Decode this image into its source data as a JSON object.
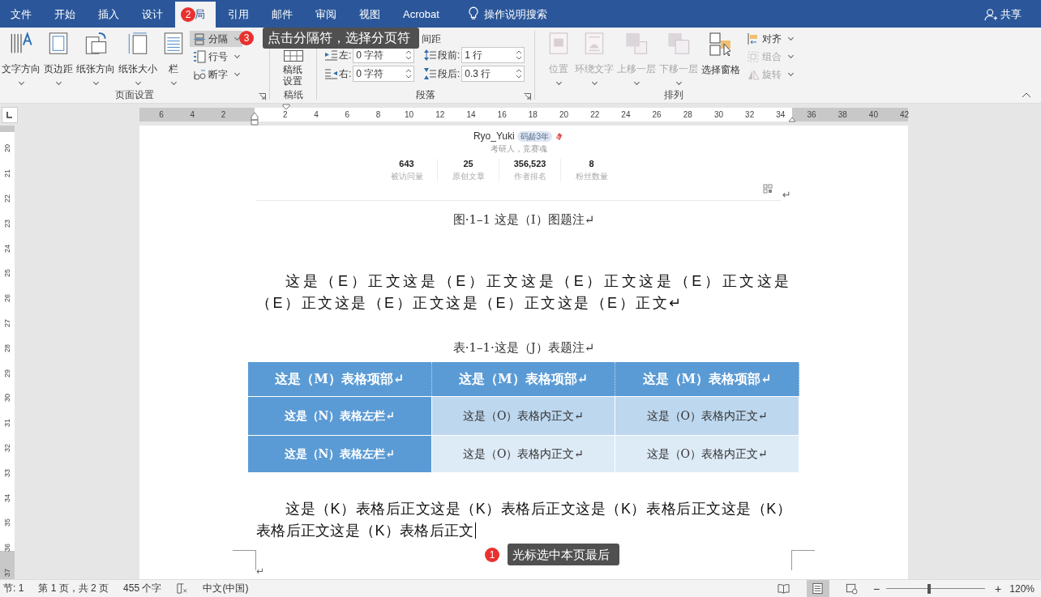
{
  "tabs": [
    {
      "label": "文件",
      "selected": false
    },
    {
      "label": "开始",
      "selected": false
    },
    {
      "label": "插入",
      "selected": false
    },
    {
      "label": "设计",
      "selected": false
    },
    {
      "label": "局",
      "selected": true,
      "badge": "2"
    },
    {
      "label": "引用",
      "selected": false
    },
    {
      "label": "邮件",
      "selected": false
    },
    {
      "label": "审阅",
      "selected": false
    },
    {
      "label": "视图",
      "selected": false
    },
    {
      "label": "Acrobat",
      "selected": false
    }
  ],
  "tell_me": "操作说明搜索",
  "share": "共享",
  "page_setup": {
    "title": "页面设置",
    "buttons": [
      {
        "label": "文字方向"
      },
      {
        "label": "页边距"
      },
      {
        "label": "纸张方向"
      },
      {
        "label": "纸张大小"
      },
      {
        "label": "栏"
      }
    ],
    "small": [
      {
        "label": "分隔",
        "selected": true
      },
      {
        "label": "行号",
        "selected": false
      },
      {
        "label": "断字",
        "selected": false
      }
    ]
  },
  "manuscript": {
    "title": "稿纸",
    "button": "稿纸设置"
  },
  "paragraph": {
    "title": "段落",
    "spacing_heading": "间距",
    "fields": [
      {
        "label": "左:",
        "value": "0 字符"
      },
      {
        "label": "段前:",
        "value": "1 行"
      },
      {
        "label": "右:",
        "value": "0 字符"
      },
      {
        "label": "段后:",
        "value": "0.3 行"
      }
    ]
  },
  "arrange": {
    "title": "排列",
    "buttons": [
      {
        "label": "位置",
        "disabled": true
      },
      {
        "label": "环绕文字",
        "disabled": true
      },
      {
        "label": "上移一层",
        "disabled": true
      },
      {
        "label": "下移一层",
        "disabled": true
      },
      {
        "label": "选择窗格",
        "disabled": false
      }
    ],
    "small": [
      {
        "label": "对齐",
        "disabled": false
      },
      {
        "label": "组合",
        "disabled": true
      },
      {
        "label": "旋转",
        "disabled": true
      }
    ]
  },
  "callouts": [
    {
      "number": "3",
      "text": "点击分隔符，选择分页符"
    },
    {
      "number": "1",
      "text": "光标选中本页最后"
    }
  ],
  "ruler": [
    "6",
    "4",
    "2",
    "2",
    "4",
    "6",
    "8",
    "10",
    "12",
    "14",
    "16",
    "18",
    "20",
    "22",
    "24",
    "26",
    "28",
    "30",
    "32",
    "34",
    "36",
    "38",
    "40",
    "42"
  ],
  "vertical_ruler": [
    "20",
    "21",
    "22",
    "23",
    "24",
    "25",
    "26",
    "27",
    "28",
    "29",
    "30",
    "31",
    "32",
    "33",
    "34",
    "35",
    "36",
    "37"
  ],
  "document": {
    "profile": {
      "name": "Ryo_Yuki",
      "badge": "码龄3年",
      "tagline": "考研人，竞赛魂",
      "stats": [
        {
          "value": "643",
          "label": "被访问量"
        },
        {
          "value": "25",
          "label": "原创文章"
        },
        {
          "value": "356,523",
          "label": "作者排名"
        },
        {
          "value": "8",
          "label": "粉丝数量"
        }
      ]
    },
    "after_card_mark": "↵",
    "figure_caption": "图·1–1 这是（I）图题注↵",
    "paragraph_1": "这是（E）正文这是（E）正文这是（E）正文这是（E）正文这是（E）正文这是（E）正文这是（E）正文这是（E）正文↵",
    "table_caption": "表·1–1·这是（J）表题注↵",
    "table": {
      "header": [
        "这是（M）表格项部↵",
        "这是（M）表格项部↵",
        "这是（M）表格项部↵"
      ],
      "rows": [
        [
          "这是（N）表格左栏↵",
          "这是（O）表格内正文↵",
          "这是（O）表格内正文↵"
        ],
        [
          "这是（N）表格左栏↵",
          "这是（O）表格内正文↵",
          "这是（O）表格内正文↵"
        ]
      ]
    },
    "paragraph_2": "这是（K）表格后正文这是（K）表格后正文这是（K）表格后正文这是（K）表格后正文这是（K）表格后正文",
    "end_mark": "↵"
  },
  "status": {
    "section": "节: 1",
    "page": "第 1 页，共 2 页",
    "words": "455 个字",
    "language": "中文(中国)",
    "views": [
      {
        "selected": false
      },
      {
        "selected": true
      },
      {
        "selected": false
      }
    ],
    "zoom_out": "−",
    "zoom_in": "+",
    "zoom": {
      "level": 0.43
    },
    "zoom_label": "120%"
  }
}
